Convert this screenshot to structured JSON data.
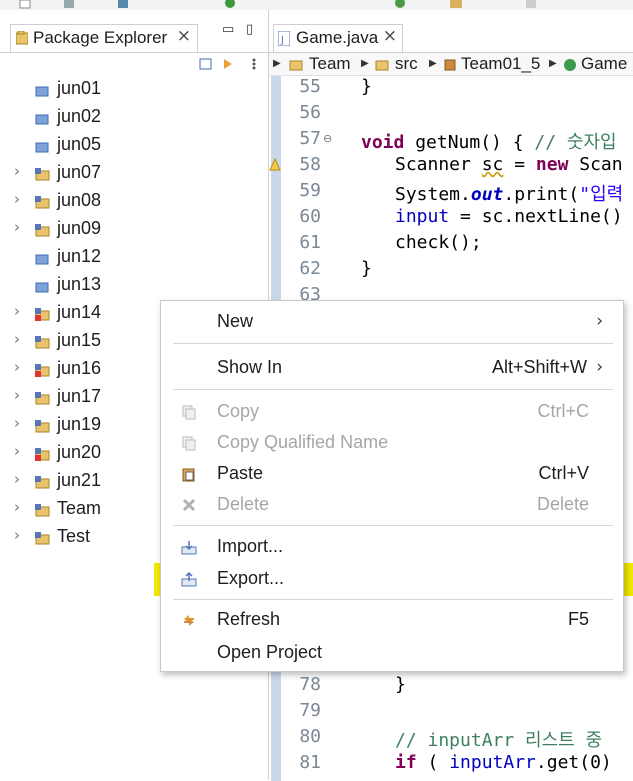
{
  "package_explorer": {
    "tab_label": "Package Explorer",
    "close_glyph": "×",
    "projects": [
      {
        "name": "jun01",
        "expandable": false,
        "icon": "package-folder-icon"
      },
      {
        "name": "jun02",
        "expandable": false,
        "icon": "package-folder-icon"
      },
      {
        "name": "jun05",
        "expandable": false,
        "icon": "package-folder-icon"
      },
      {
        "name": "jun07",
        "expandable": true,
        "icon": "java-project-icon"
      },
      {
        "name": "jun08",
        "expandable": true,
        "icon": "java-project-icon"
      },
      {
        "name": "jun09",
        "expandable": true,
        "icon": "java-project-icon"
      },
      {
        "name": "jun12",
        "expandable": false,
        "icon": "package-folder-icon"
      },
      {
        "name": "jun13",
        "expandable": false,
        "icon": "package-folder-icon"
      },
      {
        "name": "jun14",
        "expandable": true,
        "icon": "java-project-error-icon"
      },
      {
        "name": "jun15",
        "expandable": true,
        "icon": "java-project-icon"
      },
      {
        "name": "jun16",
        "expandable": true,
        "icon": "java-project-error-icon"
      },
      {
        "name": "jun17",
        "expandable": true,
        "icon": "java-project-icon"
      },
      {
        "name": "jun19",
        "expandable": true,
        "icon": "java-project-icon"
      },
      {
        "name": "jun20",
        "expandable": true,
        "icon": "java-project-error-icon"
      },
      {
        "name": "jun21",
        "expandable": true,
        "icon": "java-project-icon"
      },
      {
        "name": "Team",
        "expandable": true,
        "icon": "java-project-icon"
      },
      {
        "name": "Test",
        "expandable": true,
        "icon": "java-project-icon"
      }
    ]
  },
  "editor": {
    "tab_label": "Game.java",
    "close_glyph": "×",
    "breadcrumb": [
      "Team",
      "src",
      "Team01_5",
      "Game"
    ],
    "line_numbers": {
      "n55": "55",
      "n56": "56",
      "n57": "57",
      "n58": "58",
      "n59": "59",
      "n60": "60",
      "n61": "61",
      "n62": "62",
      "n63": "63",
      "n78": "78",
      "n79": "79",
      "n80": "80",
      "n81": "81"
    },
    "code": {
      "l55": "}",
      "l57_kw": "void",
      "l57_rest": " getNum() { ",
      "l57_cm": "// 숫자입",
      "l58_a": "Scanner ",
      "l58_var": "sc",
      "l58_b": " = ",
      "l58_kw": "new",
      "l58_c": " Scan",
      "l59_a": "System.",
      "l59_out": "out",
      "l59_b": ".print(",
      "l59_str": "\"입력",
      "l60_fld": "input",
      "l60_a": " = ",
      "l60_var": "sc",
      "l60_b": ".nextLine()",
      "l61": "check();",
      "l62": "}",
      "l78": "}",
      "l80_cm": "// inputArr 리스트 중",
      "l81_kw": "if",
      "l81_a": " ( ",
      "l81_fld": "inputArr",
      "l81_b": ".get(0)"
    }
  },
  "context_menu": {
    "items": [
      {
        "label": "New",
        "accelerator": "",
        "submenu": true,
        "enabled": true
      },
      {
        "label": "Show In",
        "accelerator": "Alt+Shift+W",
        "submenu": true,
        "enabled": true
      },
      {
        "label": "Copy",
        "accelerator": "Ctrl+C",
        "submenu": false,
        "enabled": false
      },
      {
        "label": "Copy Qualified Name",
        "accelerator": "",
        "submenu": false,
        "enabled": false
      },
      {
        "label": "Paste",
        "accelerator": "Ctrl+V",
        "submenu": false,
        "enabled": true
      },
      {
        "label": "Delete",
        "accelerator": "Delete",
        "submenu": false,
        "enabled": false
      },
      {
        "label": "Import...",
        "accelerator": "",
        "submenu": false,
        "enabled": true
      },
      {
        "label": "Export...",
        "accelerator": "",
        "submenu": false,
        "enabled": true,
        "highlighted": true
      },
      {
        "label": "Refresh",
        "accelerator": "F5",
        "submenu": false,
        "enabled": true
      },
      {
        "label": "Open Project",
        "accelerator": "",
        "submenu": false,
        "enabled": true
      }
    ],
    "submenu_glyph": "›",
    "highlight_color": "#f2e800"
  },
  "colors": {
    "keyword": "#7f0055",
    "comment": "#3f7f5f",
    "field": "#0000c0",
    "string": "#2a00ff"
  }
}
